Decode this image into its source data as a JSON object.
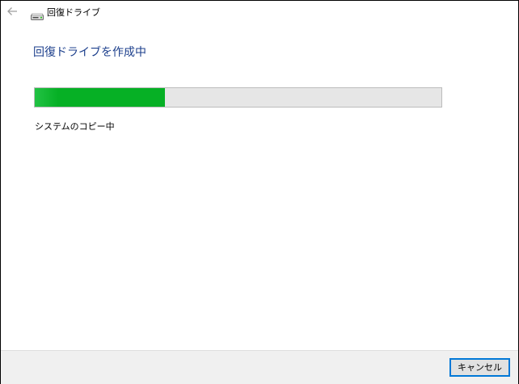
{
  "window": {
    "title": "回復ドライブ"
  },
  "main": {
    "heading": "回復ドライブを作成中",
    "progress": {
      "fraction": 0.32,
      "status_text": "システムのコピー中"
    }
  },
  "footer": {
    "cancel_label": "キャンセル"
  },
  "icons": {
    "back": "back-arrow-icon",
    "drive": "drive-icon"
  },
  "colors": {
    "heading": "#1c3f8c",
    "progress_fill": "#06b025",
    "progress_track": "#e6e6e6",
    "button_border": "#0078d7",
    "footer_bg": "#f0f0f0"
  }
}
